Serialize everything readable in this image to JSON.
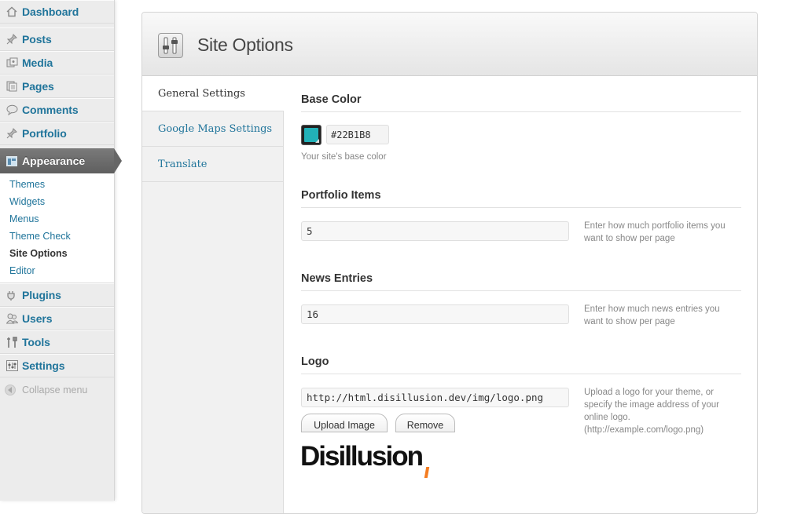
{
  "sidebar": {
    "items": [
      {
        "label": "Dashboard",
        "icon": "dashboard-icon"
      },
      {
        "label": "Posts",
        "icon": "pin-icon"
      },
      {
        "label": "Media",
        "icon": "media-icon"
      },
      {
        "label": "Pages",
        "icon": "pages-icon"
      },
      {
        "label": "Comments",
        "icon": "comment-icon"
      },
      {
        "label": "Portfolio",
        "icon": "pin-icon"
      },
      {
        "label": "Appearance",
        "icon": "appearance-icon"
      },
      {
        "label": "Plugins",
        "icon": "plug-icon"
      },
      {
        "label": "Users",
        "icon": "users-icon"
      },
      {
        "label": "Tools",
        "icon": "tools-icon"
      },
      {
        "label": "Settings",
        "icon": "settings-icon"
      }
    ],
    "submenu": [
      "Themes",
      "Widgets",
      "Menus",
      "Theme Check",
      "Site Options",
      "Editor"
    ],
    "collapse_label": "Collapse menu"
  },
  "page": {
    "title": "Site Options",
    "tabs": [
      "General Settings",
      "Google Maps Settings",
      "Translate"
    ]
  },
  "base_color": {
    "title": "Base Color",
    "value": "#22B1B8",
    "note": "Your site's base color"
  },
  "portfolio": {
    "title": "Portfolio Items",
    "value": "5",
    "hint": "Enter how much portfolio items you want to show per page"
  },
  "news": {
    "title": "News Entries",
    "value": "16",
    "hint": "Enter how much news entries you want to show per page"
  },
  "logo": {
    "title": "Logo",
    "value": "http://html.disillusion.dev/img/logo.png",
    "hint": "Upload a logo for your theme, or specify the image address of your online logo. (http://example.com/logo.png)",
    "upload_label": "Upload Image",
    "remove_label": "Remove",
    "preview_text": "Disillusion"
  },
  "colors": {
    "link": "#21759b",
    "base": "#22B1B8",
    "logo_accent": "#f47c20"
  }
}
